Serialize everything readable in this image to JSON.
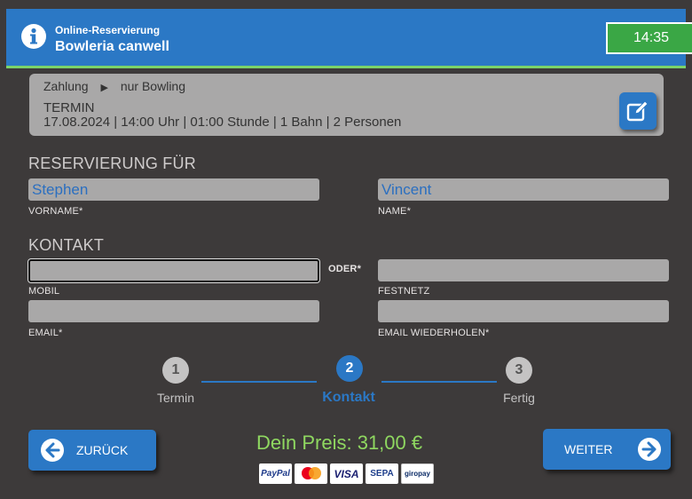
{
  "header": {
    "subtitle": "Online-Reservierung",
    "title": "Bowleria canwell",
    "time": "14:35"
  },
  "summary": {
    "crumb_first": "Zahlung",
    "crumb_second": "nur Bowling",
    "label": "TERMIN",
    "details": "17.08.2024 | 14:00 Uhr | 01:00 Stunde | 1 Bahn | 2 Personen"
  },
  "reservation": {
    "title": "RESERVIERUNG FÜR",
    "firstname_value": "Stephen",
    "firstname_label": "VORNAME*",
    "lastname_value": "Vincent",
    "lastname_label": "NAME*"
  },
  "contact": {
    "title": "KONTAKT",
    "or_label": "ODER*",
    "mobile_label": "MOBIL",
    "mobile_value": "",
    "landline_label": "FESTNETZ",
    "landline_value": "",
    "email_label": "EMAIL*",
    "email_value": "",
    "email_repeat_label": "EMAIL WIEDERHOLEN*",
    "email_repeat_value": ""
  },
  "steps": [
    {
      "number": "1",
      "label": "Termin",
      "active": false
    },
    {
      "number": "2",
      "label": "Kontakt",
      "active": true
    },
    {
      "number": "3",
      "label": "Fertig",
      "active": false
    }
  ],
  "footer": {
    "back_label": "ZURÜCK",
    "next_label": "WEITER",
    "price": "Dein Preis: 31,00 €",
    "payment_methods": [
      "PayPal",
      "mastercard",
      "VISA",
      "SEPA",
      "giropay"
    ]
  },
  "colors": {
    "background": "#3d3a3a",
    "accent": "#2b78c5",
    "success": "#3aa745",
    "price": "#8fd860",
    "field": "#a9a8a8"
  }
}
